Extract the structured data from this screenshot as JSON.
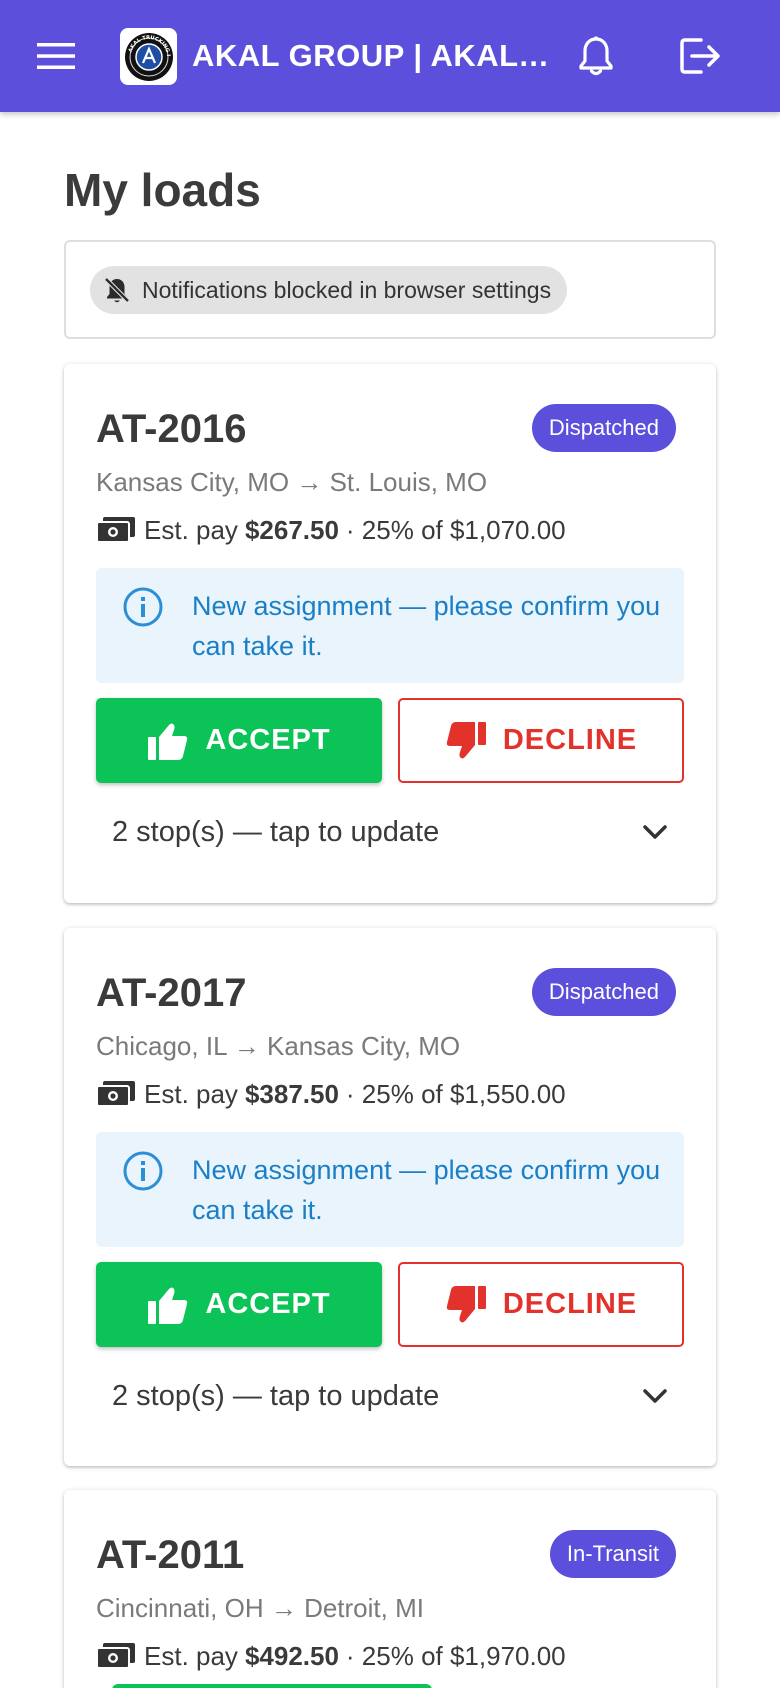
{
  "header": {
    "title": "AKAL GROUP | AKAL T…",
    "logo_text": "AKAL TRUCKING INC",
    "icons": {
      "menu": "menu-icon",
      "notifications": "bell-icon",
      "logout": "logout-icon"
    },
    "color": "#5b4fdc"
  },
  "page": {
    "title": "My loads"
  },
  "notice": {
    "text": "Notifications blocked in browser settings",
    "icon": "bell-off-icon"
  },
  "loads": [
    {
      "id": "AT-2016",
      "status": "Dispatched",
      "route": "Kansas City, MO → St. Louis, MO",
      "pay_prefix": "Est. pay",
      "pay_amount": "$267.50",
      "pay_suffix": "· 25% of $1,070.00",
      "alert": "New assignment — please confirm you can take it.",
      "accept_label": "ACCEPT",
      "decline_label": "DECLINE",
      "stops_label": "2 stop(s) — tap to update"
    },
    {
      "id": "AT-2017",
      "status": "Dispatched",
      "route": "Chicago, IL → Kansas City, MO",
      "pay_prefix": "Est. pay",
      "pay_amount": "$387.50",
      "pay_suffix": "· 25% of $1,550.00",
      "alert": "New assignment — please confirm you can take it.",
      "accept_label": "ACCEPT",
      "decline_label": "DECLINE",
      "stops_label": "2 stop(s) — tap to update"
    },
    {
      "id": "AT-2011",
      "status": "In-Transit",
      "route": "Cincinnati, OH → Detroit, MI",
      "pay_prefix": "Est. pay",
      "pay_amount": "$492.50",
      "pay_suffix": "· 25% of $1,970.00"
    }
  ],
  "colors": {
    "accent": "#5b4fdc",
    "accept": "#0bc356",
    "decline": "#e3322c",
    "info": "#1a7fc6",
    "info_bg": "#eaf4fc"
  }
}
